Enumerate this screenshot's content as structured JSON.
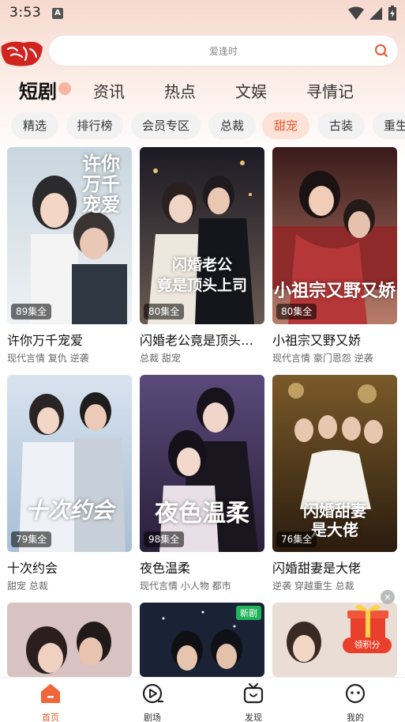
{
  "status_bar": {
    "time": "3:53",
    "keyboard_badge": "A"
  },
  "search": {
    "placeholder": "爱逢时"
  },
  "top_tabs": [
    {
      "label": "短剧",
      "active": true
    },
    {
      "label": "资讯",
      "active": false
    },
    {
      "label": "热点",
      "active": false
    },
    {
      "label": "文娱",
      "active": false
    },
    {
      "label": "寻情记",
      "active": false
    }
  ],
  "chips": [
    {
      "label": "精选"
    },
    {
      "label": "排行榜"
    },
    {
      "label": "会员专区"
    },
    {
      "label": "总裁"
    },
    {
      "label": "甜宠",
      "active": true
    },
    {
      "label": "古装"
    },
    {
      "label": "重生"
    }
  ],
  "cards": [
    {
      "title": "许你万千宠爱",
      "episodes": "89集全",
      "tags": "现代言情 复仇 逆袭",
      "poster_text": "许你万千宠爱"
    },
    {
      "title": "闪婚老公竟是顶头上司",
      "episodes": "80集全",
      "tags": "总裁 甜宠",
      "poster_text": "闪婚老公竟是顶头上司"
    },
    {
      "title": "小祖宗又野又娇",
      "episodes": "80集全",
      "tags": "现代言情 豪门恩怨 逆袭",
      "poster_text": "小祖宗又野又娇"
    },
    {
      "title": "十次约会",
      "episodes": "79集全",
      "tags": "甜宠 总裁",
      "poster_text": "十次约会"
    },
    {
      "title": "夜色温柔",
      "episodes": "98集全",
      "tags": "现代言情 小人物 都市",
      "poster_text": "夜色温柔"
    },
    {
      "title": "闪婚甜妻是大佬",
      "episodes": "76集全",
      "tags": "逆袭 穿越重生 总裁",
      "poster_text": "闪婚甜妻是大佬"
    }
  ],
  "partial_row": {
    "new_badge": "新剧"
  },
  "promo": {
    "label": "领积分",
    "close": "×"
  },
  "bottom_nav": [
    {
      "label": "首页",
      "icon": "home-icon",
      "active": true
    },
    {
      "label": "剧场",
      "icon": "play-circle-icon"
    },
    {
      "label": "发现",
      "icon": "tv-icon"
    },
    {
      "label": "我的",
      "icon": "face-icon"
    }
  ],
  "colors": {
    "accent": "#e8582b",
    "chip_bg": "#f2f2f2",
    "chip_active_bg": "#fde2d7",
    "new_badge": "#1fb35a"
  }
}
